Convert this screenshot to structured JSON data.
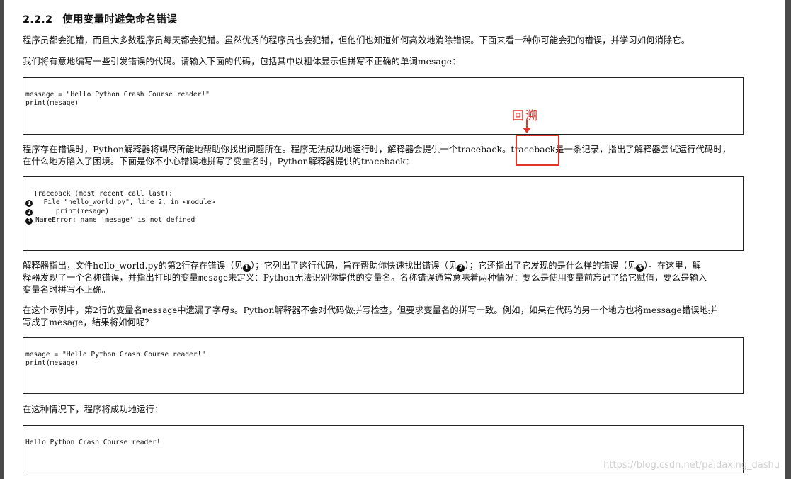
{
  "heading": {
    "number": "2.2.2",
    "title": "使用变量时避免命名错误"
  },
  "paragraphs": {
    "p1": "程序员都会犯错，而且大多数程序员每天都会犯错。虽然优秀的程序员也会犯错，但他们也知道如何高效地消除错误。下面来看一种你可能会犯的错误，并学习如何消除它。",
    "p2": "我们将有意地编写一些引发错误的代码。请输入下面的代码，包括其中以粗体显示但拼写不正确的单词mesage：",
    "p3_line1": "程序存在错误时，Python解释器将竭尽所能地帮助你找出问题所在。程序无法成功地运行时，解释器会提供一个traceback。traceback是一条记录，指出了解释器尝试运行代码时，",
    "p3_line2": "在什么地方陷入了困境。下面是你不小心错误地拼写了变量名时，Python解释器提供的traceback：",
    "p4_a": "解释器指出，文件hello_world.py的第2行存在错误（见",
    "p4_b": "）；它列出了这行代码，旨在帮助你快速找出错误（见",
    "p4_c": "）；它还指出了它发现的是什么样的错误（见",
    "p4_d": "）。在这里，解",
    "p4_line2_a": "释器发现了一个名称错误，并指出打印的变量",
    "p4_line2_mono": "mesage",
    "p4_line2_b": "未定义：Python无法识别你提供的变量名。名称错误通常意味着两种情况：要么是使用变量前忘记了给它赋值，要么是输入",
    "p4_line3": "变量名时拼写不正确。",
    "p5_line1_a": "在这个示例中，第2行的变量名",
    "p5_line1_mono": "message",
    "p5_line1_b": "中遗漏了字母s。Python解释器不会对代码做拼写检查，但要求变量名的拼写一致。例如，如果在代码的另一个地方也将message错误地拼",
    "p5_line2": "写成了mesage，结果将如何呢？",
    "p6": "在这种情况下，程序将成功地运行："
  },
  "markers": [
    "1",
    "2",
    "3"
  ],
  "code1": {
    "line1": "message = \"Hello Python Crash Course reader!\"",
    "line2": "print(mesage)"
  },
  "code2": {
    "line1": "  Traceback (most recent call last):",
    "line2": "  File \"hello_world.py\", line 2, in <module>",
    "line3": "     print(mesage)",
    "line4": "NameError: name 'mesage' is not defined"
  },
  "code3": {
    "line1": "mesage = \"Hello Python Crash Course reader!\"",
    "line2": "print(mesage)"
  },
  "code4": {
    "line1": "Hello Python Crash Course reader!"
  },
  "annotation": {
    "label": "回溯",
    "color": "#e0352a"
  },
  "watermark": "https://blog.csdn.net/paidaxing_dashu"
}
